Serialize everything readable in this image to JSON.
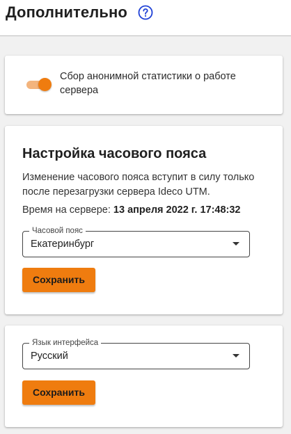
{
  "header": {
    "title": "Дополнительно",
    "help_icon": "help-circle-icon"
  },
  "stats": {
    "toggle_on": true,
    "label": "Сбор анонимной статистики о работе сервера"
  },
  "timezone": {
    "title": "Настройка часового пояса",
    "note": "Изменение часового пояса вступит в силу только после перезагрузки сервера Ideco UTM.",
    "server_time_label": "Время на сервере:",
    "server_time_value": "13 апреля 2022 г. 17:48:32",
    "select_legend": "Часовой пояс",
    "select_value": "Екатеринбург",
    "save_label": "Сохранить"
  },
  "language": {
    "select_legend": "Язык интерфейса",
    "select_value": "Русский",
    "save_label": "Сохранить"
  },
  "colors": {
    "accent": "#ef7c0f",
    "accent_light": "#f3b47d",
    "help_icon": "#1e40d6"
  }
}
